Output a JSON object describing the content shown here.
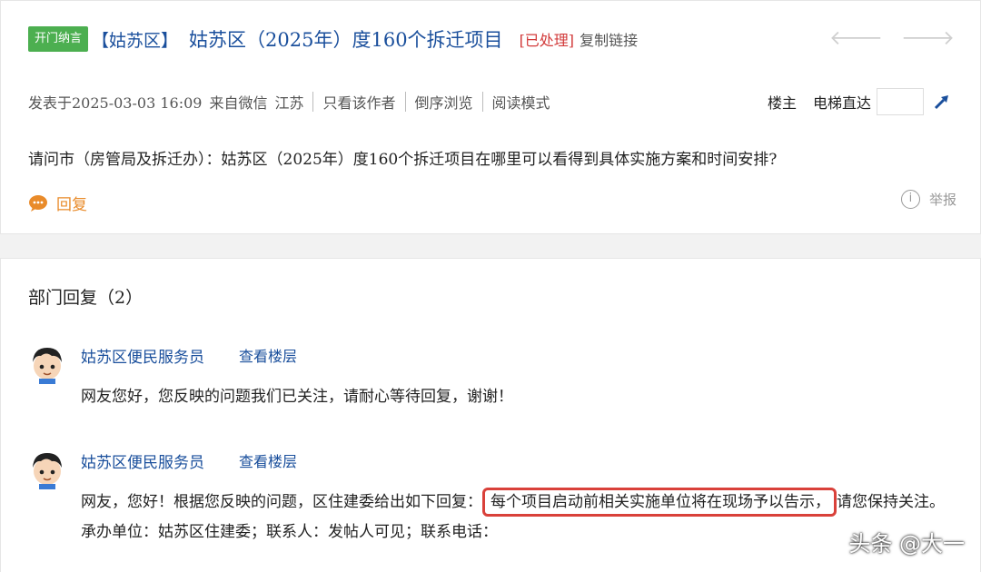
{
  "post": {
    "tag": "开门纳言",
    "region": "【姑苏区】",
    "title": "姑苏区（2025年）度160个拆迁项目",
    "status": "[已处理]",
    "copy_link": "复制链接",
    "nav_prev_icon": "arrow-left-icon",
    "nav_next_icon": "arrow-right-icon"
  },
  "meta": {
    "posted_at": "发表于2025-03-03 16:09",
    "source": "来自微信",
    "location": "江苏",
    "only_author": "只看该作者",
    "reverse_order": "倒序浏览",
    "read_mode": "阅读模式",
    "floor_owner": "楼主",
    "elevator": "电梯直达",
    "elevator_value": ""
  },
  "question": "请问市（房管局及拆迁办）：姑苏区（2025年）度160个拆迁项目在哪里可以看得到具体实施方案和时间安排?",
  "actions": {
    "reply": "回复",
    "report": "举报"
  },
  "replies_section": {
    "title": "部门回复（2）",
    "items": [
      {
        "author": "姑苏区便民服务员",
        "view_floor": "查看楼层",
        "body": "网友您好，您反映的问题我们已关注，请耐心等待回复，谢谢！"
      },
      {
        "author": "姑苏区便民服务员",
        "view_floor": "查看楼层",
        "body_pre": "网友，您好！根据您反映的问题，区住建委给出如下回复：",
        "body_highlight": "每个项目启动前相关实施单位将在现场予以告示，",
        "body_post": "请您保持关注。承办单位：姑苏区住建委；联系人：发帖人可见；联系电话："
      }
    ]
  },
  "watermark": "头条 @大一",
  "colors": {
    "tag_green": "#4caf50",
    "link_blue": "#1a4f9c",
    "status_red": "#d23a3a",
    "reply_orange": "#e98b2a",
    "highlight_red": "#d9413a"
  }
}
